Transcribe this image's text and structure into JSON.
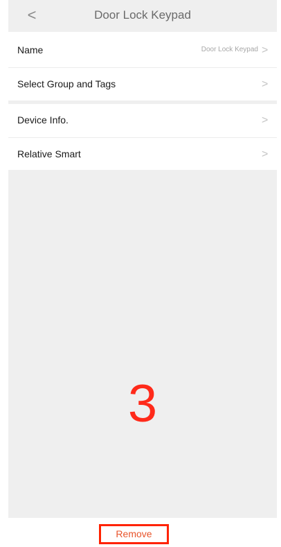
{
  "header": {
    "back_icon": "chevron-left-icon",
    "back_glyph": "<",
    "title": "Door Lock Keypad"
  },
  "section1": [
    {
      "label": "Name",
      "value": "Door Lock Keypad"
    },
    {
      "label": "Select Group and Tags",
      "value": ""
    }
  ],
  "section2": [
    {
      "label": "Device Info.",
      "value": ""
    },
    {
      "label": "Relative Smart",
      "value": ""
    }
  ],
  "chevron_glyph": ">",
  "overlay": {
    "step_number": "3"
  },
  "footer": {
    "remove_label": "Remove"
  },
  "colors": {
    "header_bg": "#efefef",
    "accent_red": "#ff2200",
    "remove_text": "#e8542b"
  }
}
